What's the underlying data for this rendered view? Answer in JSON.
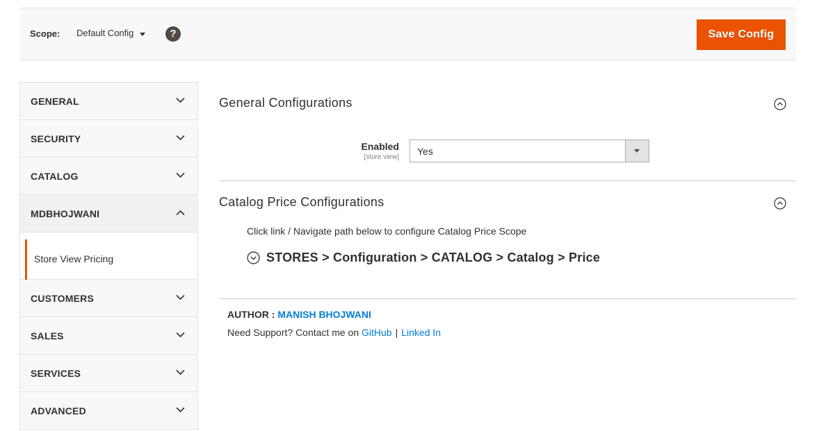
{
  "scope": {
    "label": "Scope:",
    "selected": "Default Config",
    "help_icon": "question-icon",
    "save_label": "Save Config"
  },
  "sidebar": {
    "items": [
      {
        "label": "GENERAL",
        "icon": "chevron-down-icon"
      },
      {
        "label": "SECURITY",
        "icon": "chevron-down-icon"
      },
      {
        "label": "CATALOG",
        "icon": "chevron-down-icon"
      },
      {
        "label": "MDBHOJWANI",
        "icon": "chevron-up-icon"
      },
      {
        "label": "CUSTOMERS",
        "icon": "chevron-down-icon"
      },
      {
        "label": "SALES",
        "icon": "chevron-down-icon"
      },
      {
        "label": "SERVICES",
        "icon": "chevron-down-icon"
      },
      {
        "label": "ADVANCED",
        "icon": "chevron-down-icon"
      }
    ],
    "sub_item": "Store View Pricing"
  },
  "main": {
    "general": {
      "title": "General Configurations",
      "enabled_label": "Enabled",
      "enabled_scope": "[store view]",
      "enabled_value": "Yes"
    },
    "catalog_price": {
      "title": "Catalog Price Configurations",
      "hint": "Click link / Navigate path below to configure Catalog Price Scope",
      "path": "STORES > Configuration > CATALOG > Catalog > Price"
    },
    "author": {
      "label": "AUTHOR :",
      "name": "MANISH BHOJWANI",
      "support_text": "Need Support? Contact me on",
      "github": "GitHub",
      "separator": "|",
      "linkedin": "Linked In"
    }
  },
  "colors": {
    "accent": "#eb5202",
    "link": "#007bdb"
  }
}
